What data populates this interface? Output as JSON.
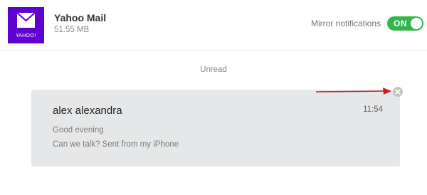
{
  "header": {
    "app_name": "Yahoo Mail",
    "app_size": "51.55 MB",
    "icon": {
      "name": "yahoo-mail-icon",
      "wordmark": "YAHOO!",
      "bg_color": "#5f01d1"
    },
    "mirror_label": "Mirror notifications",
    "toggle": {
      "label": "ON",
      "state": "on",
      "color": "#34b44a"
    }
  },
  "section": {
    "label": "Unread"
  },
  "notification": {
    "sender": "alex alexandra",
    "time": "11:54",
    "lines": [
      "Good evening",
      "Can we talk? Sent from my iPhone"
    ],
    "dismiss_icon": "close-circle-icon",
    "card_color": "#e6e7e8"
  },
  "annotation": {
    "arrow_color": "#cc1f1f"
  }
}
